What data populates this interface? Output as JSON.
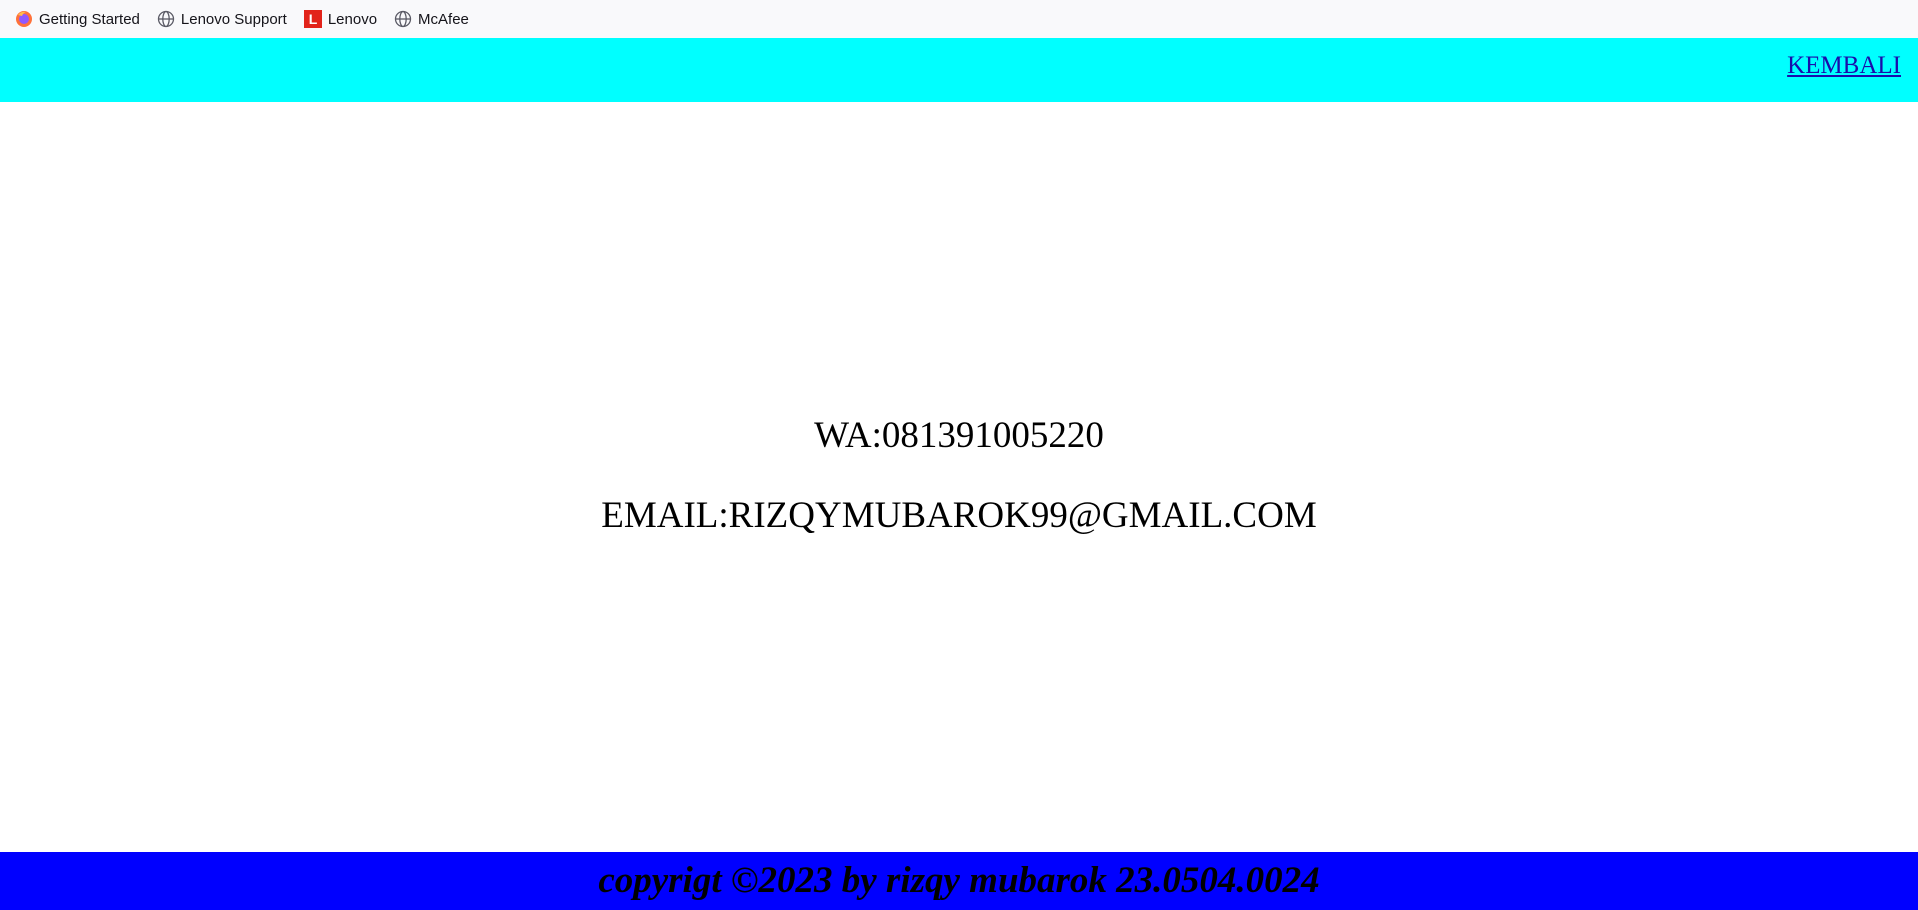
{
  "bookmarks": [
    {
      "label": "Getting Started",
      "icon": "firefox-icon"
    },
    {
      "label": "Lenovo Support",
      "icon": "globe-icon"
    },
    {
      "label": "Lenovo",
      "icon": "lenovo-logo-icon"
    },
    {
      "label": "McAfee",
      "icon": "globe-icon"
    }
  ],
  "header": {
    "back_label": "KEMBALI",
    "background": "#00ffff"
  },
  "contact": {
    "wa": "WA:081391005220",
    "email": "EMAIL:RIZQYMUBAROK99@GMAIL.COM"
  },
  "footer": {
    "text": "copyrigt ©2023 by rizqy mubarok 23.0504.0024",
    "background": "#0000ff"
  }
}
